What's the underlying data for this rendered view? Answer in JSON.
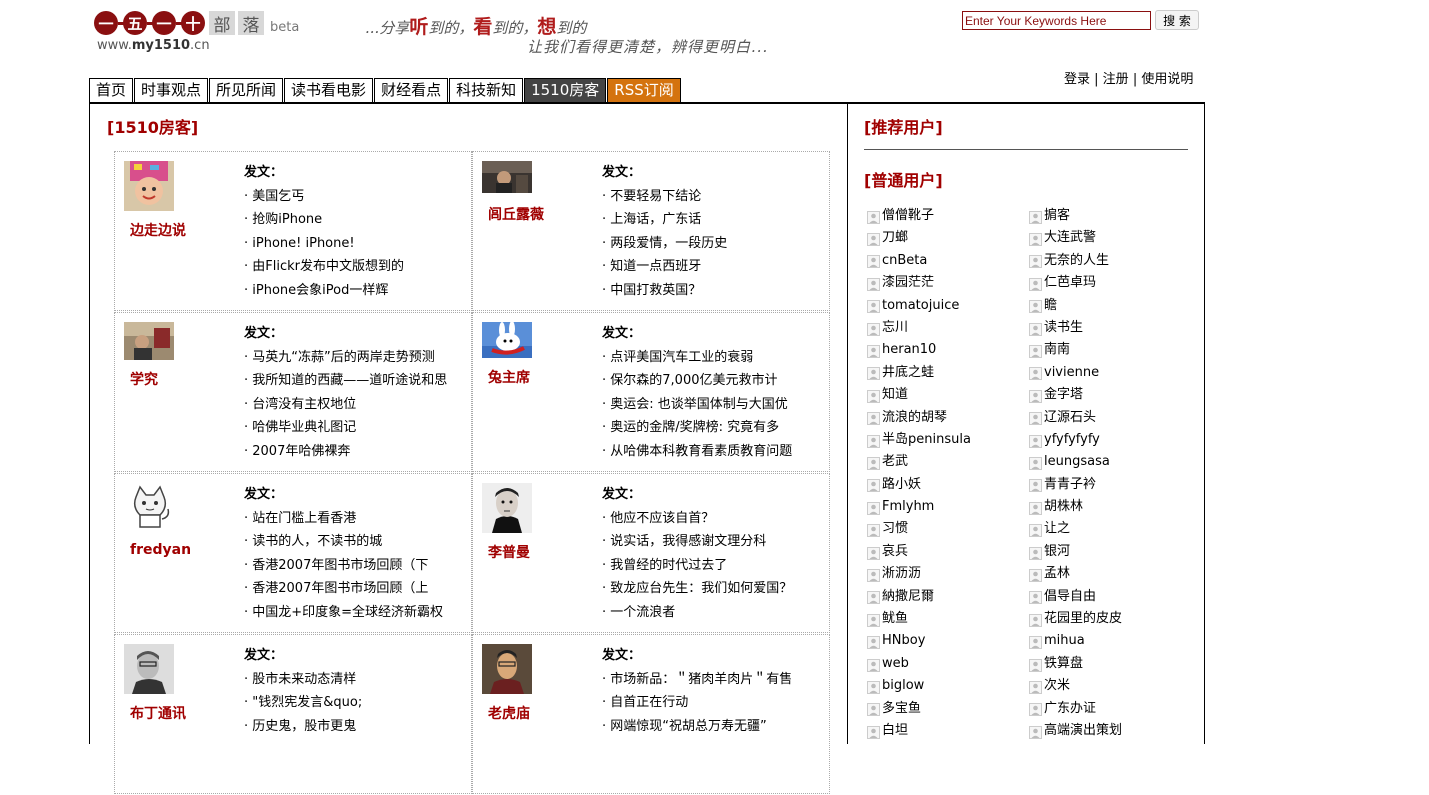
{
  "header": {
    "logo": {
      "chars": [
        "一",
        "五",
        "一",
        "十"
      ],
      "suffix": [
        "部",
        "落"
      ],
      "beta": "beta",
      "url_prefix": "www.",
      "url_bold": "my1510",
      "url_suffix": ".cn"
    },
    "slogan_line1": {
      "lead": "...分享",
      "w1": "听",
      "t1": "到的，",
      "w2": "看",
      "t2": "到的，",
      "w3": "想",
      "t3": "到的"
    },
    "slogan_line2": "让我们看得更清楚，辨得更明白...",
    "search": {
      "value": "Enter Your Keywords Here",
      "button": "搜 索"
    },
    "user_links": [
      "登录",
      "注册",
      "使用说明"
    ]
  },
  "nav": {
    "tabs": [
      {
        "label": "首页"
      },
      {
        "label": "时事观点"
      },
      {
        "label": "所见所闻"
      },
      {
        "label": "读书看电影"
      },
      {
        "label": "财经看点"
      },
      {
        "label": "科技新知"
      },
      {
        "label": "1510房客",
        "state": "active"
      },
      {
        "label": "RSS订阅",
        "state": "rss"
      }
    ]
  },
  "main": {
    "title": "[1510房客]",
    "posts_label": "发文：",
    "bloggers": [
      {
        "name": "边走边说",
        "posts": [
          "美国乞丐",
          "抢购iPhone",
          "iPhone! iPhone!",
          "由Flickr发布中文版想到的",
          "iPhone会象iPod一样辉"
        ]
      },
      {
        "name": "闾丘露薇",
        "posts": [
          "不要轻易下结论",
          "上海话，广东话",
          "两段爱情，一段历史",
          "知道一点西班牙",
          "中国打救英国？"
        ]
      },
      {
        "name": "学究",
        "posts": [
          "马英九“冻蒜”后的两岸走势预测",
          "我所知道的西藏——道听途说和思",
          "台湾没有主权地位",
          "哈佛毕业典礼图记",
          "2007年哈佛裸奔"
        ]
      },
      {
        "name": "兔主席",
        "posts": [
          "点评美国汽车工业的衰弱",
          "保尔森的7,000亿美元救市计",
          "奥运会: 也谈举国体制与大国优",
          "奥运的金牌/奖牌榜: 究竟有多",
          "从哈佛本科教育看素质教育问题"
        ]
      },
      {
        "name": "fredyan",
        "posts": [
          "站在门槛上看香港",
          "读书的人，不读书的城",
          "香港2007年图书市场回顾（下",
          "香港2007年图书市场回顾（上",
          "中国龙+印度象=全球经济新霸权"
        ]
      },
      {
        "name": "李普曼",
        "posts": [
          "他应不应该自首？",
          "说实话，我得感谢文理分科",
          "我曾经的时代过去了",
          "致龙应台先生：我们如何爱国？",
          "一个流浪者"
        ]
      },
      {
        "name": "布丁通讯",
        "posts": [
          "股市未来动态清样",
          "\"钱烈宪发言&quo;",
          "历史鬼，股市更鬼"
        ]
      },
      {
        "name": "老虎庙",
        "posts": [
          "市场新品：＂猪肉羊肉片＂有售",
          "自首正在行动",
          "网端惊现“祝胡总万寿无疆”"
        ]
      }
    ]
  },
  "side": {
    "recommended_title": "[推荐用户]",
    "common_title": "[普通用户]",
    "users": [
      "僧僧靴子",
      "掮客",
      "刀螂",
      "大连武警",
      "cnBeta",
      "无奈的人生",
      "漆园茫茫",
      "仁芭卓玛",
      "tomatojuice",
      "瞻",
      "忘川",
      "读书生",
      "heran10",
      "南南",
      "井底之蛙",
      "vivienne",
      "知道",
      "金字塔",
      "流浪的胡琴",
      "辽源石头",
      "半岛peninsula",
      "yfyfyfyfy",
      "老武",
      "leungsasa",
      "路小妖",
      "青青子衿",
      "Fmlyhm",
      "胡株林",
      "习惯",
      "让之",
      "哀兵",
      "银河",
      "淅沥沥",
      "孟林",
      "納撒尼爾",
      "倡导自由",
      "鱿鱼",
      "花园里的皮皮",
      "HNboy",
      "mihua",
      "web",
      "铁算盘",
      "biglow",
      "次米",
      "多宝鱼",
      "广东办证",
      "白坦",
      "高端演出策划"
    ]
  }
}
